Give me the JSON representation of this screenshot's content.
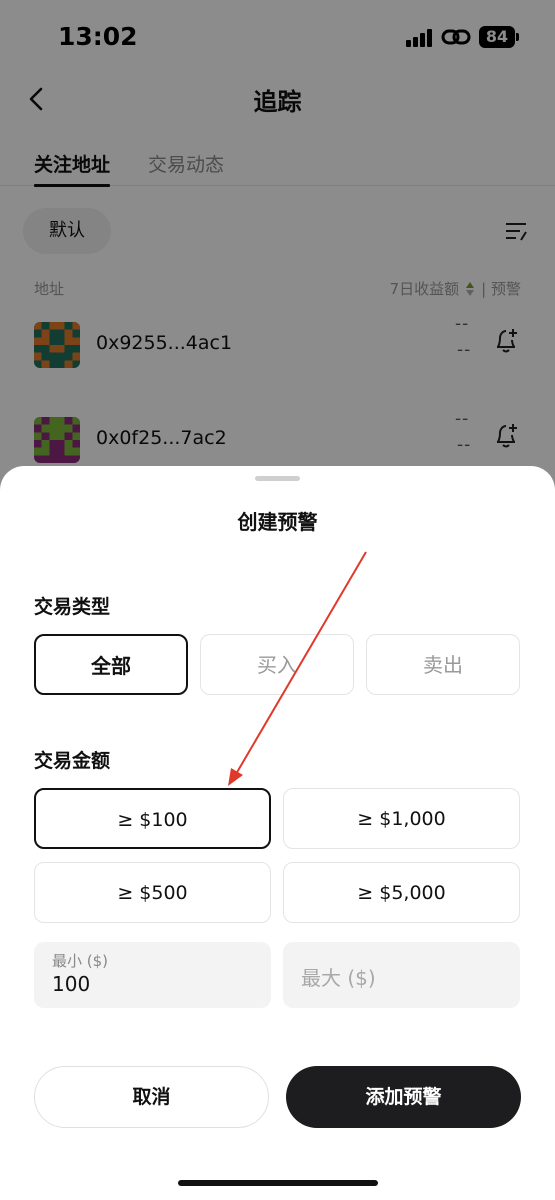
{
  "status_bar": {
    "time": "13:02",
    "battery": "84"
  },
  "nav": {
    "title": "追踪"
  },
  "tabs": [
    {
      "label": "关注地址",
      "active": true
    },
    {
      "label": "交易动态",
      "active": false
    }
  ],
  "filter": {
    "chip_label": "默认"
  },
  "list_header": {
    "address": "地址",
    "profit_7d": "7日收益额",
    "separator": "|",
    "alert": "预警"
  },
  "addresses": [
    {
      "address": "0x9255...4ac1",
      "value_top": "--",
      "value_bottom": "--"
    },
    {
      "address": "0x0f25...7ac2",
      "value_top": "--",
      "value_bottom": "--"
    }
  ],
  "sheet": {
    "title": "创建预警",
    "trade_type_label": "交易类型",
    "trade_types": [
      {
        "label": "全部",
        "selected": true
      },
      {
        "label": "买入",
        "selected": false
      },
      {
        "label": "卖出",
        "selected": false
      }
    ],
    "trade_amount_label": "交易金额",
    "amounts": [
      {
        "label": "≥ $100",
        "selected": true
      },
      {
        "label": "≥ $1,000",
        "selected": false
      },
      {
        "label": "≥ $500",
        "selected": false
      },
      {
        "label": "≥ $5,000",
        "selected": false
      }
    ],
    "min_input": {
      "label": "最小 ($)",
      "value": "100"
    },
    "max_input": {
      "placeholder": "最大 ($)"
    },
    "cancel_label": "取消",
    "confirm_label": "添加预警"
  },
  "colors": {
    "primary": "#1d1d1f",
    "annotation_arrow": "#e0392b",
    "overlay": "rgba(0,0,0,0.45)"
  }
}
